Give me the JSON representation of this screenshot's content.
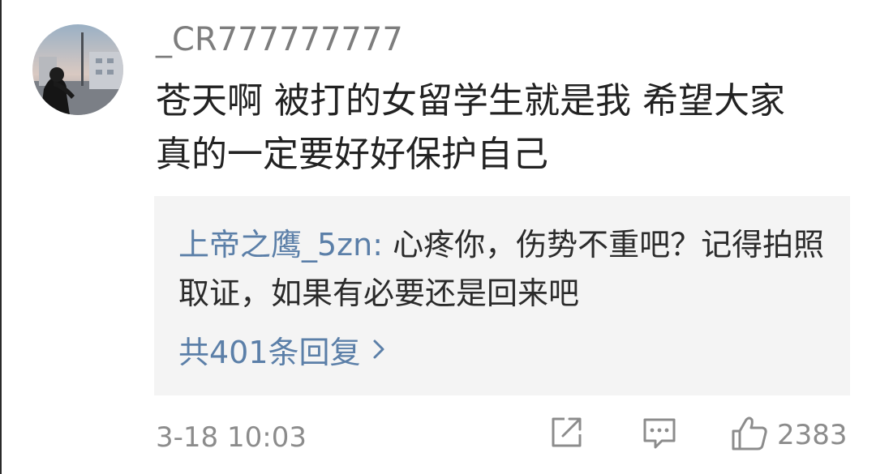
{
  "comment": {
    "username": "_CR777777777",
    "text": "苍天啊 被打的女留学生就是我  希望大家\n真的一定要好好保护自己",
    "timestamp": "3-18 10:03",
    "like_count": "2383"
  },
  "reply": {
    "author": "上帝之鹰_5zn:",
    "text": " 心疼你，伤势不重吧？记得拍照取证，如果有必要还是回来吧",
    "more_label": "共401条回复"
  },
  "icons": {
    "share": "share-icon",
    "comment": "comment-icon",
    "like": "thumbs-up-icon",
    "more": "chevron-right-icon"
  },
  "colors": {
    "username": "#7d7d7d",
    "text": "#222222",
    "link": "#5b7fa8",
    "reply_bg": "#f4f4f4",
    "meta": "#8c8c8c"
  }
}
